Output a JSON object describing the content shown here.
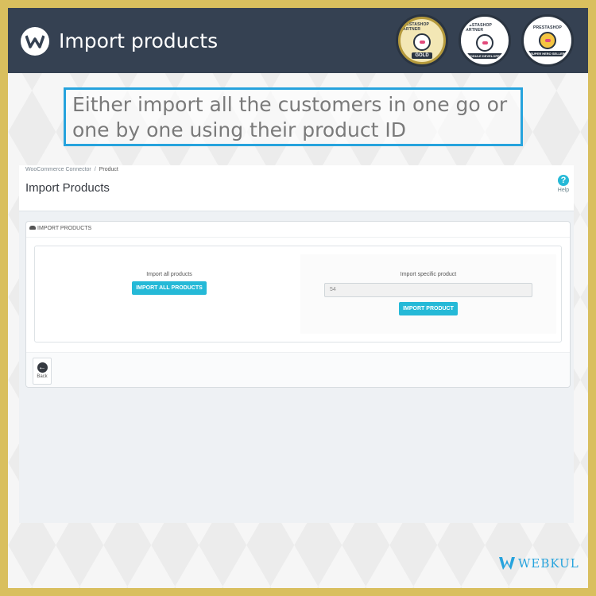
{
  "banner": {
    "title": "Import products",
    "badges": [
      {
        "ring": "PRESTASHOP PARTNER",
        "label": "GOLD",
        "color": "#b59a3c"
      },
      {
        "ring": "PRESTASHOP PARTNER",
        "label": "MODULE DEVELOPER",
        "color": "#ffffff"
      },
      {
        "ring": "PRESTASHOP",
        "label": "SUPER HERO SELLER",
        "color": "#ffffff"
      }
    ]
  },
  "caption": "Either import all the customers in one go or one by one using their product ID",
  "screen": {
    "breadcrumb": {
      "parent": "WooCommerce Connector",
      "current": "Product"
    },
    "page_title": "Import Products",
    "help_label": "Help",
    "panel": {
      "heading": "IMPORT PRODUCTS",
      "left": {
        "title": "Import all products",
        "button": "IMPORT ALL PRODUCTS"
      },
      "right": {
        "title": "Import specific product",
        "input_value": "54",
        "button": "IMPORT PRODUCT"
      },
      "back_label": "Back"
    }
  },
  "footer": {
    "brand": "WEBKUL"
  },
  "colors": {
    "accent": "#25b9d7",
    "banner_bg": "#354152",
    "frame_border": "#d9bf5e",
    "caption_border": "#26a3dd"
  }
}
